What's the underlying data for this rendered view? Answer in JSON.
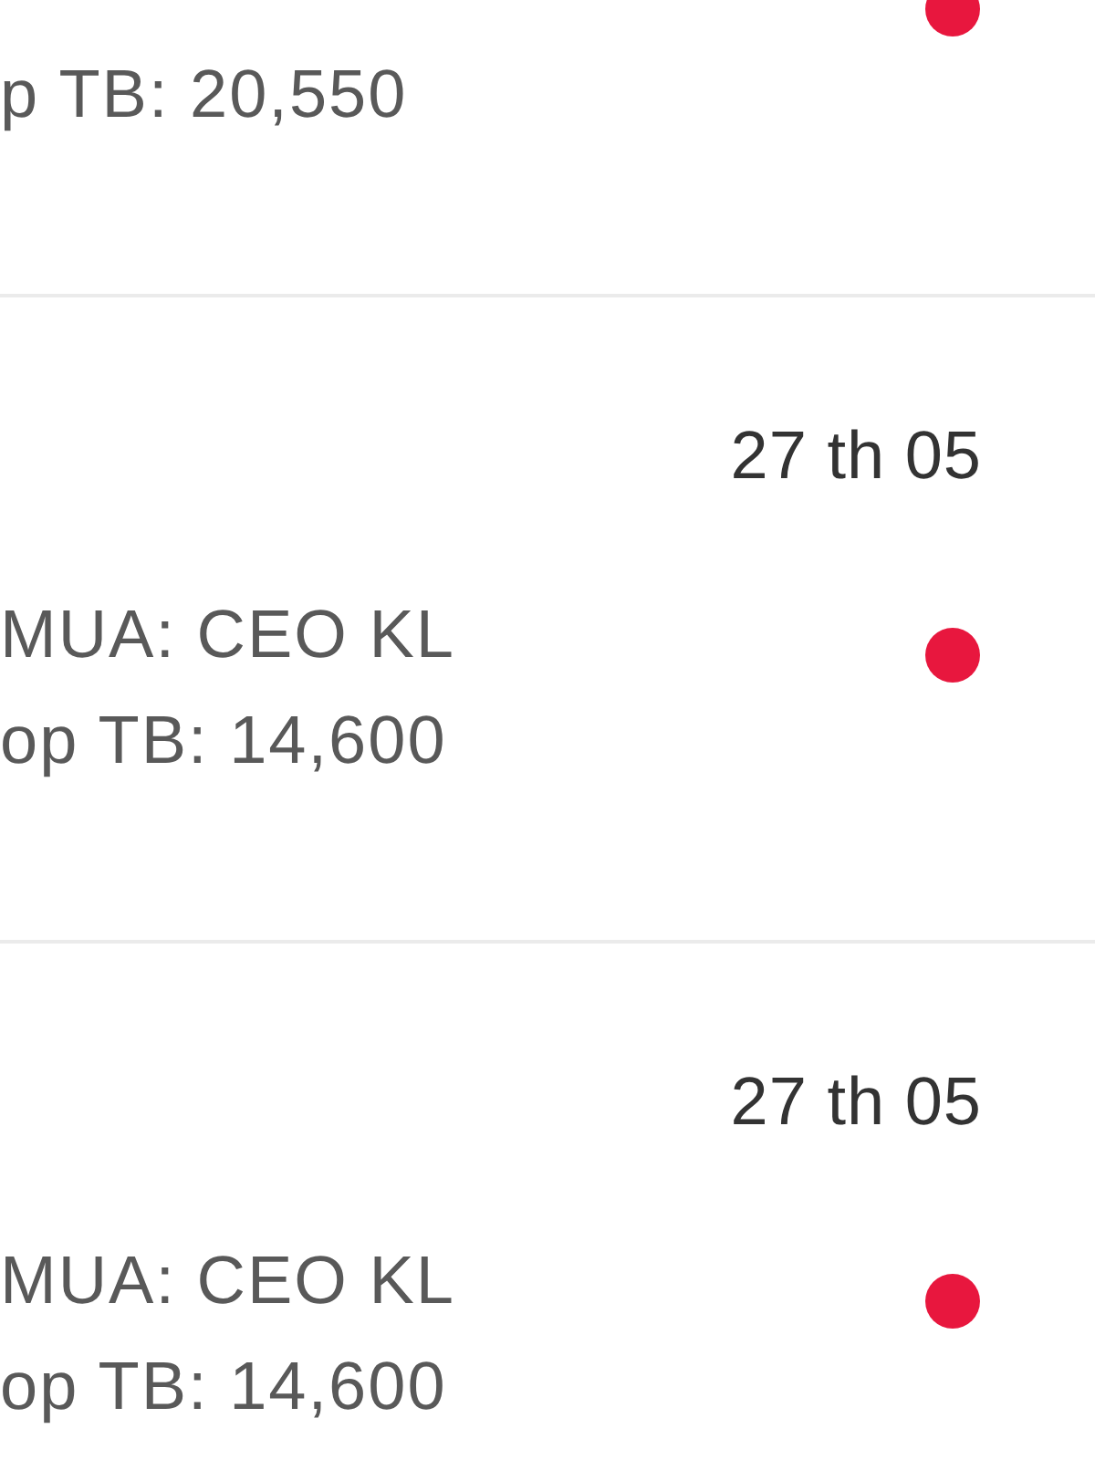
{
  "list": {
    "items": [
      {
        "avg_price": "p TB: 20,550",
        "unread": true
      },
      {
        "date": "27 th 05",
        "order": "MUA: CEO KL",
        "avg_price": "op TB: 14,600",
        "unread": true
      },
      {
        "date": "27 th 05",
        "order": "MUA: CEO KL",
        "avg_price": "op TB: 14,600",
        "unread": true
      }
    ]
  }
}
